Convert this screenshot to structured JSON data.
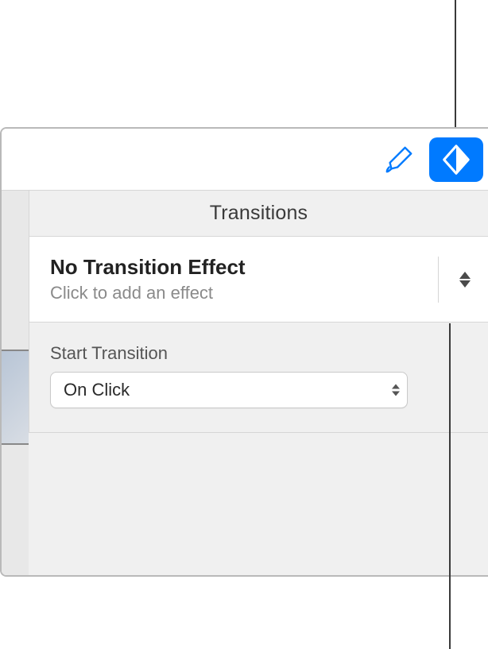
{
  "panel": {
    "title": "Transitions"
  },
  "effect": {
    "title": "No Transition Effect",
    "subtitle": "Click to add an effect"
  },
  "startTransition": {
    "label": "Start Transition",
    "value": "On Click"
  }
}
